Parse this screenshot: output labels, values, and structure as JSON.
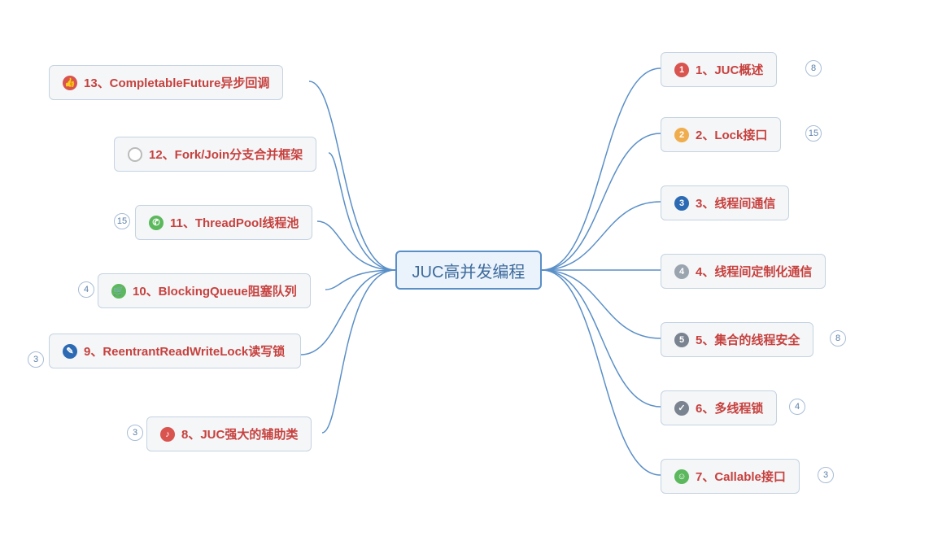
{
  "center": {
    "title": "JUC高并发编程"
  },
  "right": [
    {
      "num": "1",
      "label": "1、JUC概述",
      "count": "8",
      "iconColor": "red"
    },
    {
      "num": "2",
      "label": "2、Lock接口",
      "count": "15",
      "iconColor": "orange"
    },
    {
      "num": "3",
      "label": "3、线程间通信",
      "count": "",
      "iconColor": "blue"
    },
    {
      "num": "4",
      "label": "4、线程间定制化通信",
      "count": "",
      "iconColor": "grey"
    },
    {
      "num": "5",
      "label": "5、集合的线程安全",
      "count": "8",
      "iconColor": "darkgrey"
    },
    {
      "num": "✓",
      "label": "6、多线程锁",
      "count": "4",
      "iconColor": "check"
    },
    {
      "num": "",
      "label": "7、Callable接口",
      "count": "3",
      "iconColor": "green"
    }
  ],
  "left": [
    {
      "num": "",
      "label": "13、CompletableFuture异步回调",
      "iconColor": "white"
    },
    {
      "num": "",
      "label": "12、Fork/Join分支合并框架",
      "iconColor": "hollow"
    },
    {
      "num": "",
      "label": "11、ThreadPool线程池",
      "count": "15",
      "iconColor": "phone"
    },
    {
      "num": "",
      "label": "10、BlockingQueue阻塞队列",
      "count": "4",
      "iconColor": "cart"
    },
    {
      "num": "",
      "label": "9、ReentrantReadWriteLock读写锁",
      "count": "3",
      "iconColor": "edit"
    },
    {
      "num": "",
      "label": "8、JUC强大的辅助类",
      "count": "3",
      "iconColor": "music"
    }
  ]
}
